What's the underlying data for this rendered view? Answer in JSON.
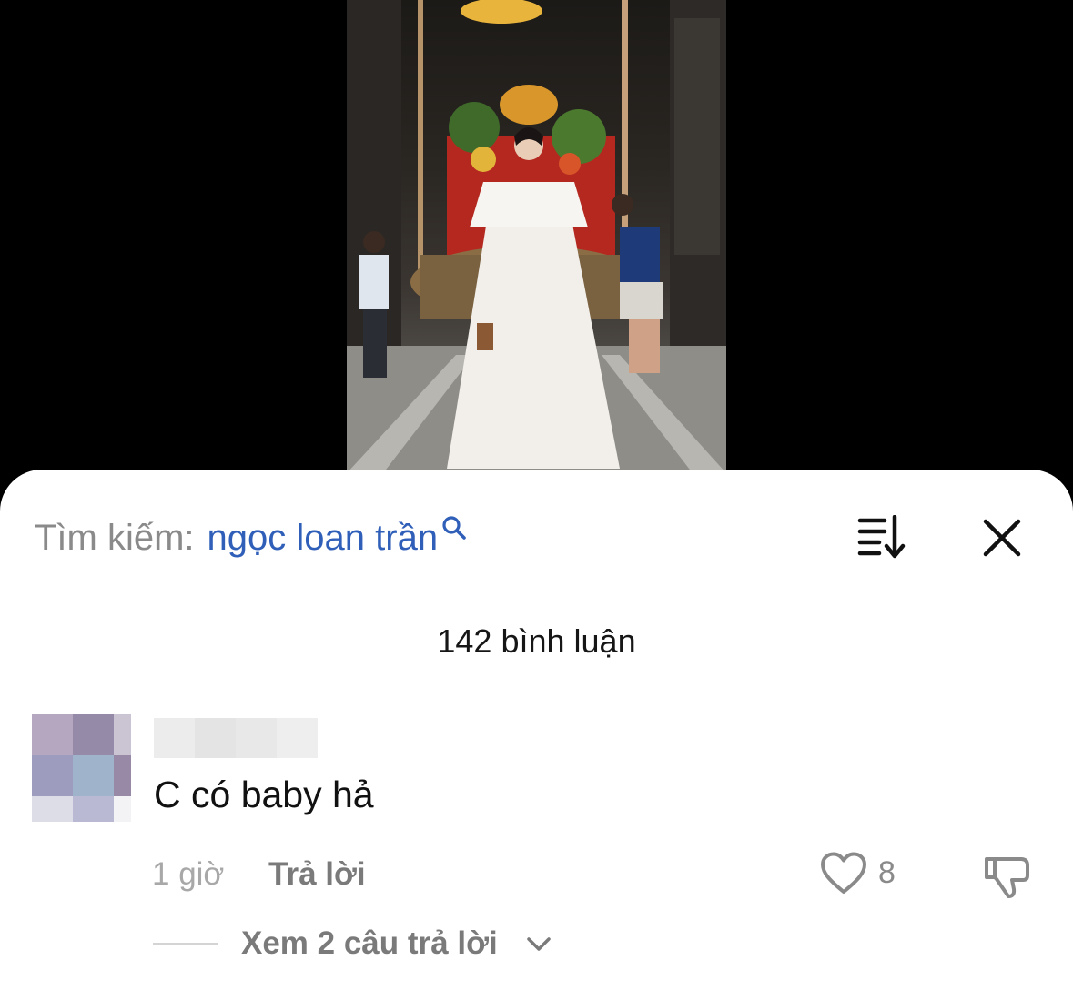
{
  "search": {
    "label": "Tìm kiếm:",
    "query": "ngọc loan trần"
  },
  "comments_header": {
    "count_text": "142 bình luận"
  },
  "comment": {
    "text": "C có baby hả",
    "time": "1 giờ",
    "reply_label": "Trả lời",
    "like_count": "8",
    "view_replies_text": "Xem 2 câu trả lời"
  },
  "icons": {
    "search": "search-icon",
    "sort": "sort-icon",
    "close": "close-icon",
    "like": "heart-icon",
    "dislike": "thumbs-down-icon",
    "expand": "chevron-down-icon"
  },
  "colors": {
    "sheet_background": "#ffffff",
    "search_query": "#2f5fb8",
    "muted_text": "#8a8a8a",
    "video_backdrop": "#000000"
  }
}
